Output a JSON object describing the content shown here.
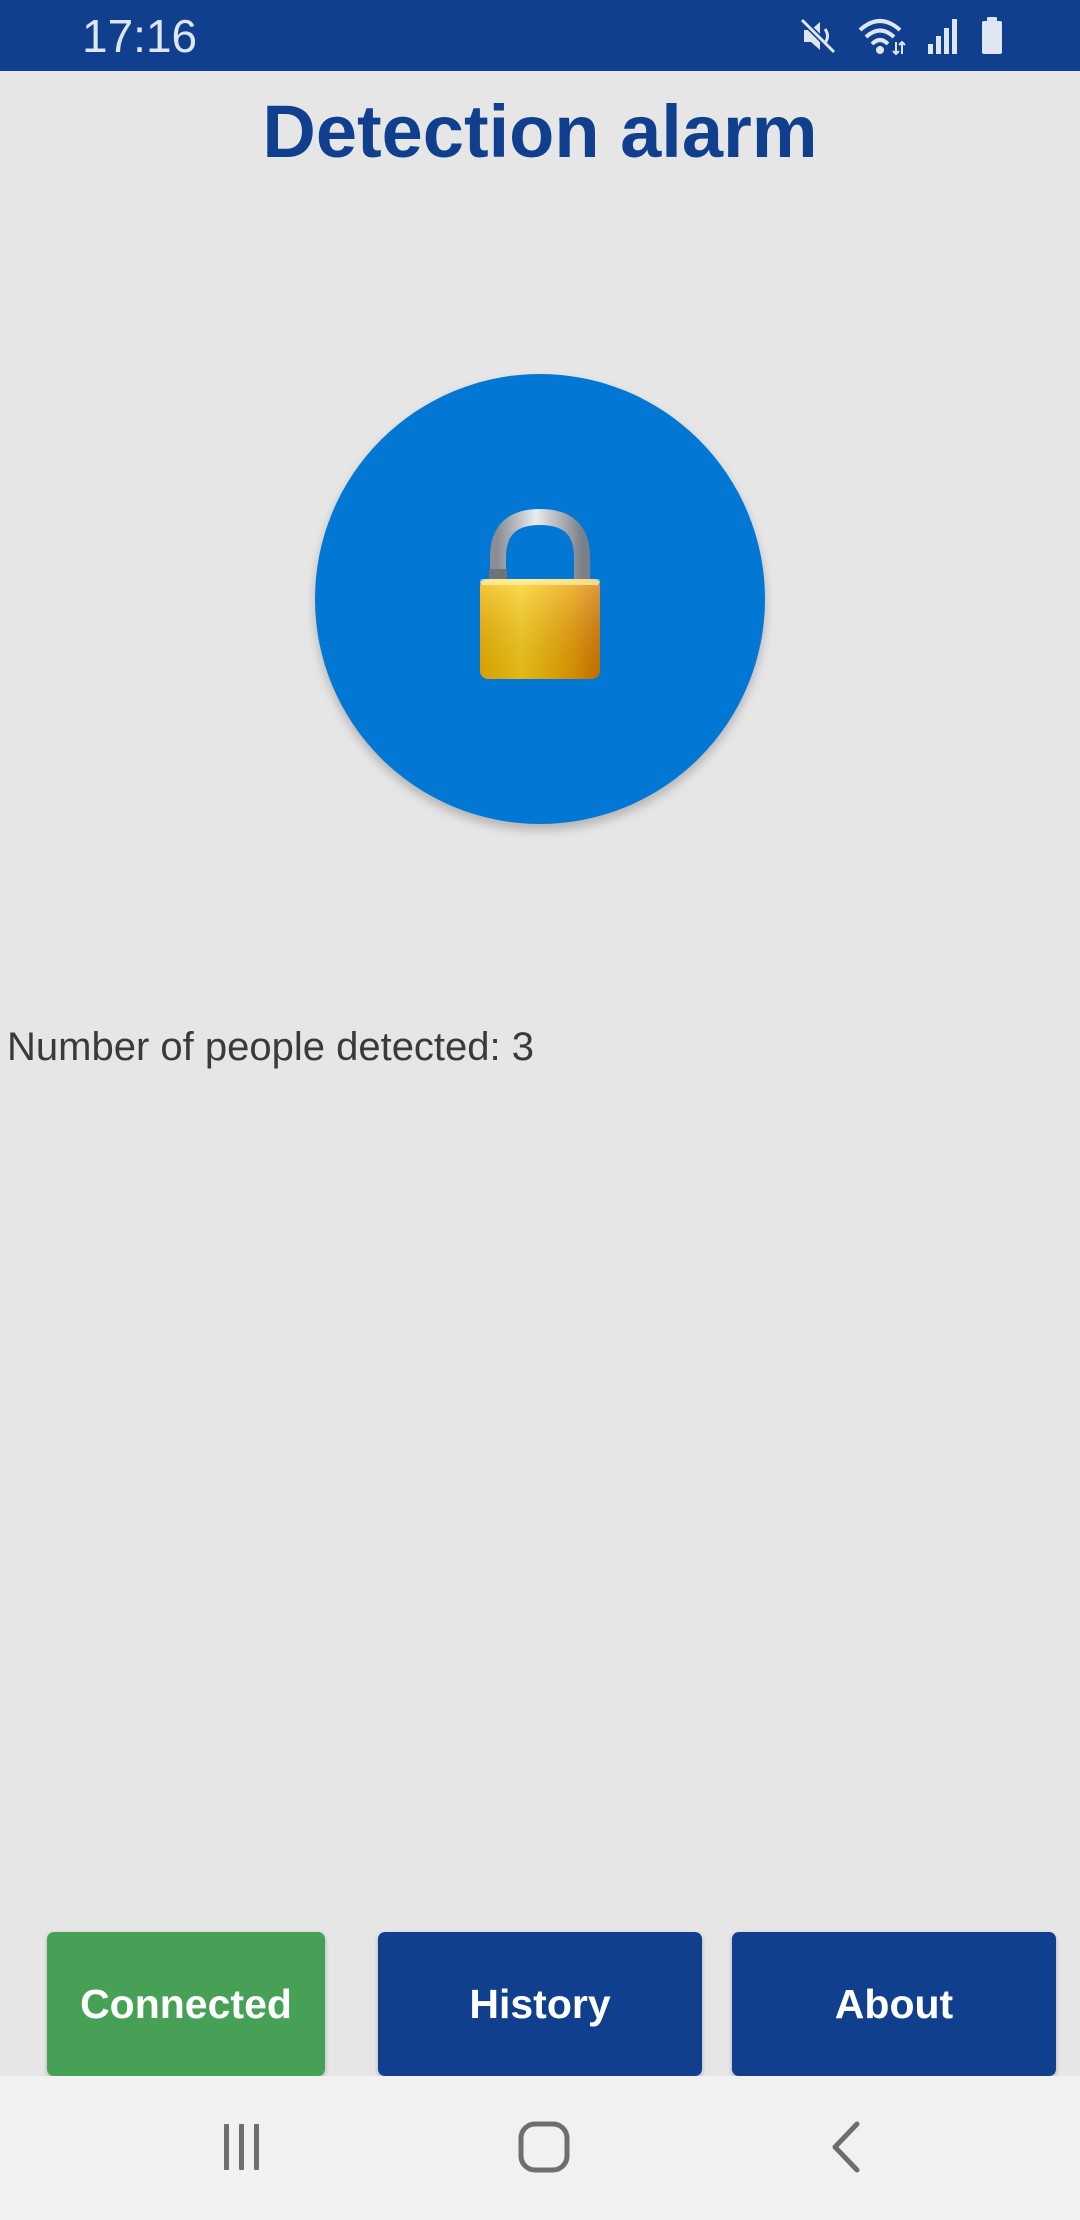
{
  "status_bar": {
    "time": "17:16",
    "icons": [
      "mute-icon",
      "wifi-icon",
      "signal-icon",
      "battery-icon"
    ],
    "background": "#103f8e"
  },
  "header": {
    "title": "Detection alarm",
    "color": "#103f8e"
  },
  "lock_control": {
    "icon": "unlocked-padlock-icon",
    "state": "unlocked",
    "background": "#0277d4"
  },
  "detection": {
    "label": "Number of people detected:",
    "count": "3"
  },
  "actions": {
    "connected_label": "Connected",
    "history_label": "History",
    "about_label": "About",
    "connected_color": "#46a157",
    "primary_color": "#103f8e"
  },
  "nav_bar": {
    "icons": [
      "recents-icon",
      "home-icon",
      "back-icon"
    ]
  }
}
